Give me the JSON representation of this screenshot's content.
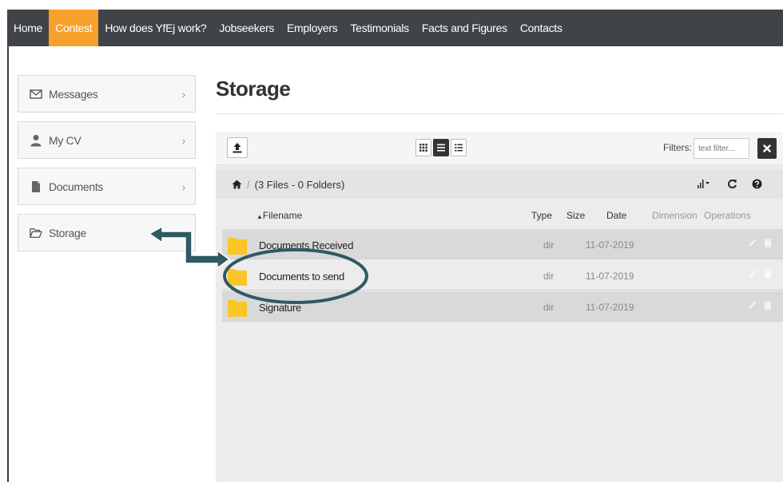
{
  "nav": {
    "items": [
      {
        "label": "Home",
        "active": false
      },
      {
        "label": "Contest",
        "active": true
      },
      {
        "label": "How does YfEj work?",
        "active": false
      },
      {
        "label": "Jobseekers",
        "active": false
      },
      {
        "label": "Employers",
        "active": false
      },
      {
        "label": "Testimonials",
        "active": false
      },
      {
        "label": "Facts and Figures",
        "active": false
      },
      {
        "label": "Contacts",
        "active": false
      }
    ]
  },
  "sidebar": {
    "items": [
      {
        "label": "Messages",
        "icon": "envelope-icon"
      },
      {
        "label": "My CV",
        "icon": "user-icon"
      },
      {
        "label": "Documents",
        "icon": "document-icon"
      },
      {
        "label": "Storage",
        "icon": "folder-open-icon"
      }
    ],
    "chevron": "›"
  },
  "page": {
    "title": "Storage"
  },
  "storage": {
    "filters_label": "Filters:",
    "filter_placeholder": "text filter...",
    "path_summary": "(3 Files - 0 Folders)",
    "path_separator": "/",
    "columns": {
      "filename": "Filename",
      "type": "Type",
      "size": "Size",
      "date": "Date",
      "dimension": "Dimension",
      "operations": "Operations"
    },
    "files": [
      {
        "name": "Documents Received",
        "type": "dir",
        "date": "11-07-2019"
      },
      {
        "name": "Documents to send",
        "type": "dir",
        "date": "11-07-2019"
      },
      {
        "name": "Signature",
        "type": "dir",
        "date": "11-07-2019"
      }
    ]
  },
  "colors": {
    "nav_bg": "#404448",
    "nav_active": "#f7a02b",
    "annotation": "#2f5a62",
    "folder": "#f9c623"
  }
}
